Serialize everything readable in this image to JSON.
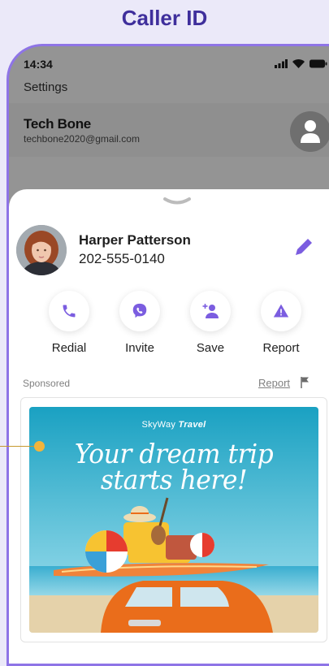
{
  "promo": {
    "title": "Caller ID"
  },
  "status_bar": {
    "time": "14:34"
  },
  "settings": {
    "title": "Settings",
    "account": {
      "name": "Tech Bone",
      "email": "techbone2020@gmail.com"
    }
  },
  "caller": {
    "name": "Harper Patterson",
    "number": "202-555-0140"
  },
  "actions": [
    {
      "label": "Redial",
      "icon": "phone-icon"
    },
    {
      "label": "Invite",
      "icon": "viber-icon"
    },
    {
      "label": "Save",
      "icon": "add-contact-icon"
    },
    {
      "label": "Report",
      "icon": "warning-icon"
    }
  ],
  "ad": {
    "sponsored_label": "Sponsored",
    "report_label": "Report",
    "brand_light": "SkyWay",
    "brand_bold": "Travel",
    "headline": "Your dream trip starts here!"
  },
  "colors": {
    "accent": "#7b5de0",
    "frame": "#8e74e6",
    "title": "#3f2f9c"
  }
}
